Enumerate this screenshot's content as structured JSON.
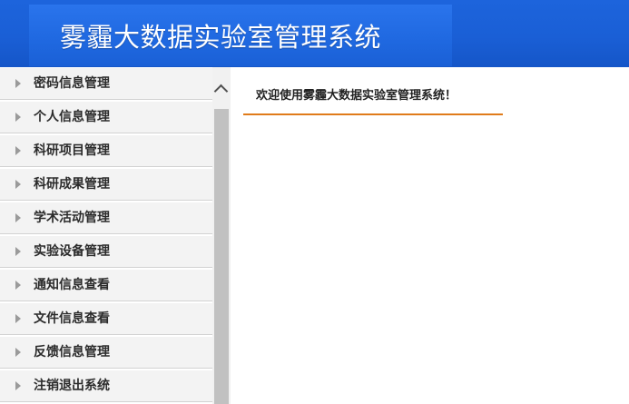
{
  "header": {
    "title": "雾霾大数据实验室管理系统"
  },
  "sidebar": {
    "items": [
      {
        "label": "密码信息管理",
        "icon": "caret-right-icon"
      },
      {
        "label": "个人信息管理",
        "icon": "caret-right-icon"
      },
      {
        "label": "科研项目管理",
        "icon": "caret-right-icon"
      },
      {
        "label": "科研成果管理",
        "icon": "caret-right-icon"
      },
      {
        "label": "学术活动管理",
        "icon": "caret-right-icon"
      },
      {
        "label": "实验设备管理",
        "icon": "caret-right-icon"
      },
      {
        "label": "通知信息查看",
        "icon": "caret-right-icon"
      },
      {
        "label": "文件信息查看",
        "icon": "caret-right-icon"
      },
      {
        "label": "反馈信息管理",
        "icon": "caret-right-icon"
      },
      {
        "label": "注销退出系统",
        "icon": "caret-right-icon"
      }
    ]
  },
  "main": {
    "welcome_text": "欢迎使用雾霾大数据实验室管理系统！"
  },
  "colors": {
    "header_blue": "#1a5fd6",
    "accent_orange": "#e07b1a",
    "menu_bg": "#f3f3f3"
  }
}
